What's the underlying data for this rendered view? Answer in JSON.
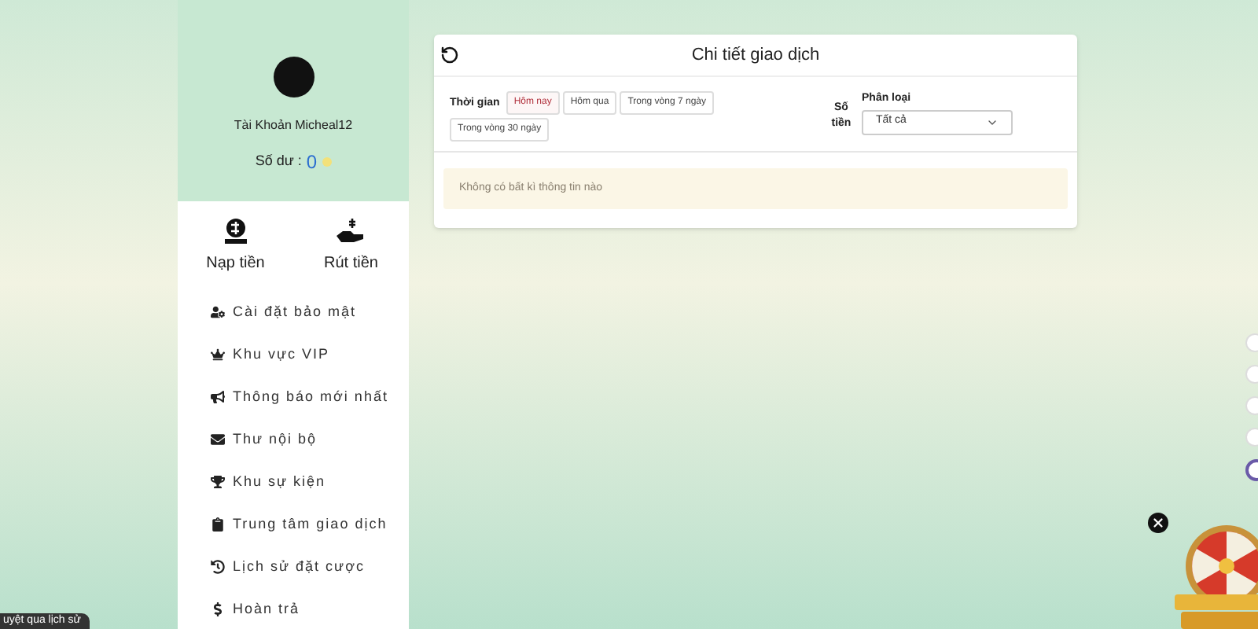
{
  "account": {
    "name": "Tài Khoản Micheal12",
    "balance_label": "Số dư :",
    "balance": "0"
  },
  "wallet_actions": [
    {
      "kind": "deposit",
      "label": "Nạp tiền"
    },
    {
      "kind": "withdraw",
      "label": "Rút tiền"
    }
  ],
  "menu": [
    {
      "kind": "security",
      "label": "Cài đặt bảo mật"
    },
    {
      "kind": "vip",
      "label": "Khu vực VIP"
    },
    {
      "kind": "news",
      "label": "Thông báo mới nhất"
    },
    {
      "kind": "mail",
      "label": "Thư nội bộ"
    },
    {
      "kind": "events",
      "label": "Khu sự kiện"
    },
    {
      "kind": "transactions",
      "label": "Trung tâm giao dịch"
    },
    {
      "kind": "history",
      "label": "Lịch sử đặt cược"
    },
    {
      "kind": "refund",
      "label": "Hoàn trả"
    }
  ],
  "tooltip": "uyệt qua lịch sử",
  "panel": {
    "title": "Chi tiết giao dịch",
    "time_label": "Thời gian",
    "time_filters": [
      {
        "label": "Hôm nay",
        "selected": true
      },
      {
        "label": "Hôm qua",
        "selected": false
      },
      {
        "label": "Trong vòng 7 ngày",
        "selected": false
      },
      {
        "label": "Trong vòng 30 ngày",
        "selected": false
      }
    ],
    "amount_label": "Số tiền",
    "category_label": "Phân loại",
    "category_value": "Tất cả",
    "empty_message": "Không có bất kì thông tin nào"
  }
}
